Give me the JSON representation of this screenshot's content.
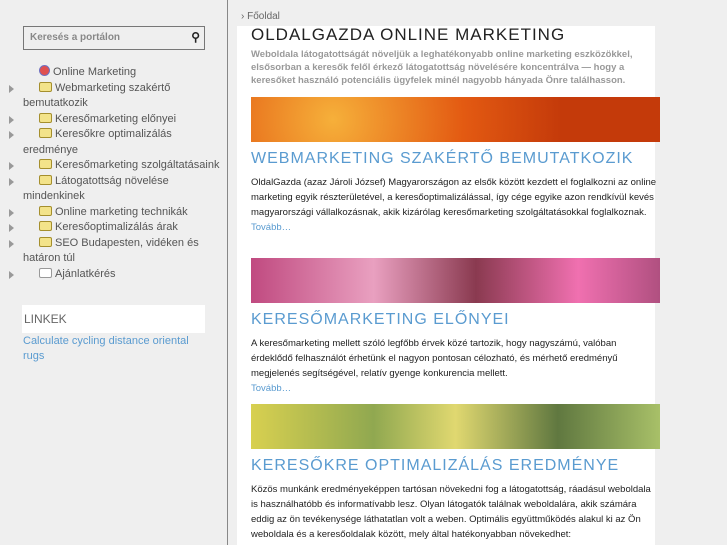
{
  "search": {
    "placeholder": "Keresés a portálon",
    "icon": "search-icon"
  },
  "nav": [
    {
      "label": "Online Marketing",
      "icon": "globe",
      "arrow": false
    },
    {
      "label": "Webmarketing szakértő",
      "label2": "bemutatkozik",
      "icon": "folder",
      "arrow": true
    },
    {
      "label": "Keresőmarketing előnyei",
      "icon": "folder",
      "arrow": true
    },
    {
      "label": "Keresőkre optimalizálás",
      "label2": "eredménye",
      "icon": "folder",
      "arrow": true
    },
    {
      "label": "Keresőmarketing szolgáltatásaink",
      "icon": "folder",
      "arrow": true
    },
    {
      "label": "Látogatottság növelése",
      "label2": "mindenkinek",
      "icon": "folder",
      "arrow": true
    },
    {
      "label": "Online marketing technikák",
      "icon": "folder",
      "arrow": true
    },
    {
      "label": "Keresőoptimalizálás árak",
      "icon": "folder",
      "arrow": true
    },
    {
      "label": "SEO Budapesten, vidéken és",
      "label2": "határon túl",
      "icon": "folder",
      "arrow": true
    },
    {
      "label": "Ajánlatkérés",
      "icon": "list",
      "arrow": true
    }
  ],
  "links": {
    "title": "LINKEK",
    "item": "Calculate cycling distance oriental rugs"
  },
  "breadcrumb": "Főoldal",
  "title": "OLDALGAZDA ONLINE MARKETING",
  "intro": "Weboldala látogatottságát növeljük a leghatékonyabb online marketing eszközökkel, elsősorban a keresők felől érkező látogatottság növelésére koncentrálva — hogy a keresőket használó potenciális ügyfelek minél nagyobb hányada Önre találhasson.",
  "articles": [
    {
      "title": "WEBMARKETING SZAKÉRTŐ BEMUTATKOZIK",
      "text": "OldalGazda (azaz Jároli József) Magyarországon az elsők között kezdett el foglalkozni az online marketing egyik részterületével, a keresőoptimalizálással, így cége egyike azon rendkívül kevés magyarországi vállalkozásnak, akik kizárólag keresőmarketing szolgáltatásokkal foglalkoznak.",
      "more": "Tovább…"
    },
    {
      "title": "KERESŐMARKETING ELŐNYEI",
      "text": "A keresőmarketing mellett szóló legfőbb érvek közé tartozik, hogy nagyszámú, valóban érdeklődő felhasználót érhetünk el nagyon pontosan célozható, és mérhető eredményű megjelenés segítségével, relatív gyenge konkurencia mellett.",
      "more": "Tovább…"
    },
    {
      "title": "KERESŐKRE OPTIMALIZÁLÁS EREDMÉNYE",
      "text": "Közös munkánk eredményeképpen tartósan növekedni fog a látogatottság, ráadásul weboldala is használhatóbb és informatívabb lesz. Olyan látogatók találnak weboldalára, akik számára eddig az ön tevékenysége láthatatlan volt a weben. Optimális együttműködés alakul ki az Ön weboldala és a keresőoldalak között, mely által hatékonyabban növekedhet:"
    }
  ]
}
